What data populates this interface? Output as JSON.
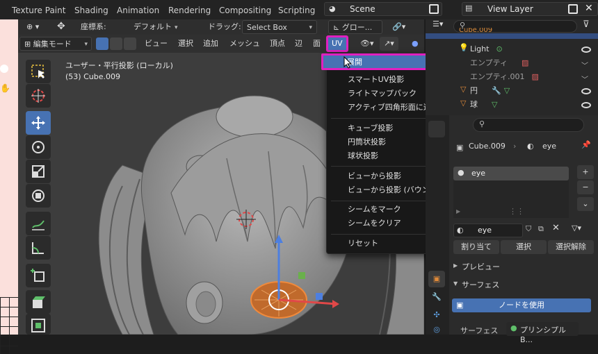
{
  "topbar": {
    "tabs": [
      "Texture Paint",
      "Shading",
      "Animation",
      "Rendering",
      "Compositing",
      "Scripting"
    ],
    "scene": "Scene",
    "view_layer": "View Layer"
  },
  "header1": {
    "coord_label": "座標系:",
    "coord_value": "デフォルト",
    "drag_label": "ドラッグ:",
    "drag_value": "Select Box",
    "pivot_value": "グロー..."
  },
  "header2": {
    "mode": "編集モード",
    "menus": [
      "ビュー",
      "選択",
      "追加",
      "メッシュ",
      "頂点",
      "辺",
      "面",
      "UV"
    ]
  },
  "viewport": {
    "title": "ユーザー・平行投影 (ローカル)",
    "subtitle": "(53) Cube.009"
  },
  "uv_menu": {
    "items": [
      "展開",
      "スマートUV投影",
      "ライトマップパック",
      "アクティブ四角形面に追従",
      "キューブ投影",
      "円筒状投影",
      "球状投影",
      "ビューから投影",
      "ビューから投影 (バウンド)",
      "シームをマーク",
      "シームをクリア",
      "リセット"
    ]
  },
  "outliner": {
    "rows": [
      {
        "name": "Cube.009"
      },
      {
        "name": "Light"
      },
      {
        "name": "エンプティ"
      },
      {
        "name": "エンプティ.001"
      },
      {
        "name": "円"
      },
      {
        "name": "球"
      }
    ]
  },
  "properties": {
    "object": "Cube.009",
    "material": "eye",
    "slot": "eye",
    "mat_field": "eye",
    "assign": "割り当て",
    "select": "選択",
    "deselect": "選択解除",
    "preview": "プレビュー",
    "surface": "サーフェス",
    "use_nodes": "ノードを使用",
    "surface_label": "サーフェス",
    "surface_value": "プリンシプルB..."
  },
  "colors": {
    "accent": "#4772b3",
    "highlight": "#e020c0",
    "skin": "#fbe0dc"
  }
}
